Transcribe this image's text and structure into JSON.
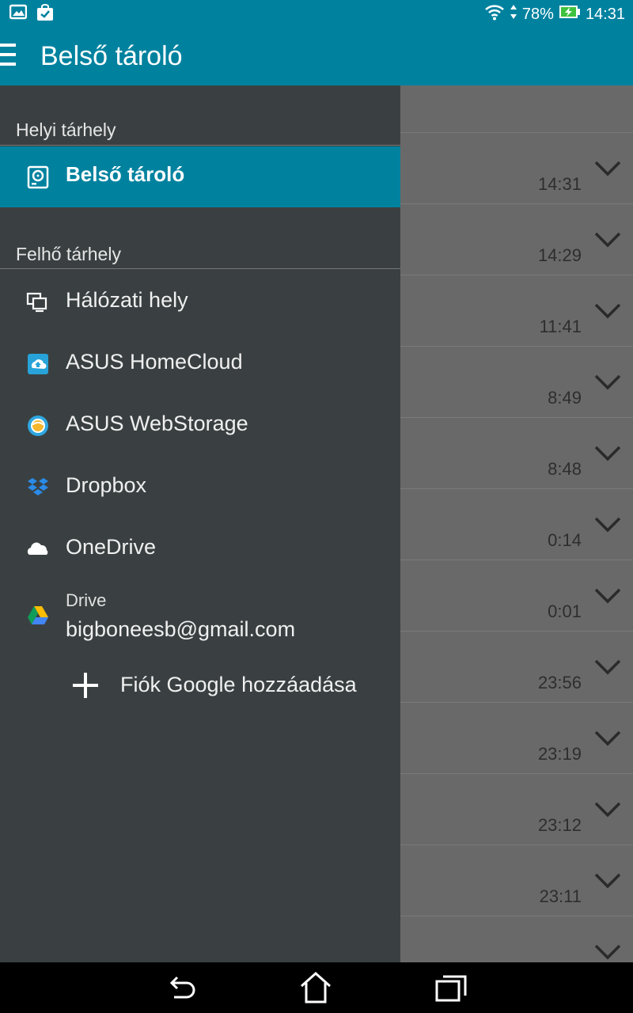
{
  "status_bar": {
    "battery": "78%",
    "time": "14:31"
  },
  "app_bar": {
    "title": "Belső tároló"
  },
  "drawer": {
    "local_header": "Helyi tárhely",
    "selected_label": "Belső tároló",
    "cloud_header": "Felhő tárhely",
    "items": [
      {
        "label": "Hálózati hely",
        "icon": "network-icon"
      },
      {
        "label": "ASUS HomeCloud",
        "icon": "homecloud-icon"
      },
      {
        "label": "ASUS WebStorage",
        "icon": "webstorage-icon"
      },
      {
        "label": "Dropbox",
        "icon": "dropbox-icon"
      },
      {
        "label": "OneDrive",
        "icon": "onedrive-icon"
      }
    ],
    "drive": {
      "label": "Drive",
      "email": "bigboneesb@gmail.com"
    },
    "add_account": "Fiók Google hozzáadása"
  },
  "background_list": {
    "times": [
      "14:31",
      "14:29",
      "11:41",
      "8:49",
      "8:48",
      "0:14",
      "0:01",
      "23:56",
      "23:19",
      "23:12",
      "23:11"
    ]
  },
  "colors": {
    "accent": "#00829f",
    "drawer_bg": "#3a4042",
    "scrim": "#696969"
  }
}
